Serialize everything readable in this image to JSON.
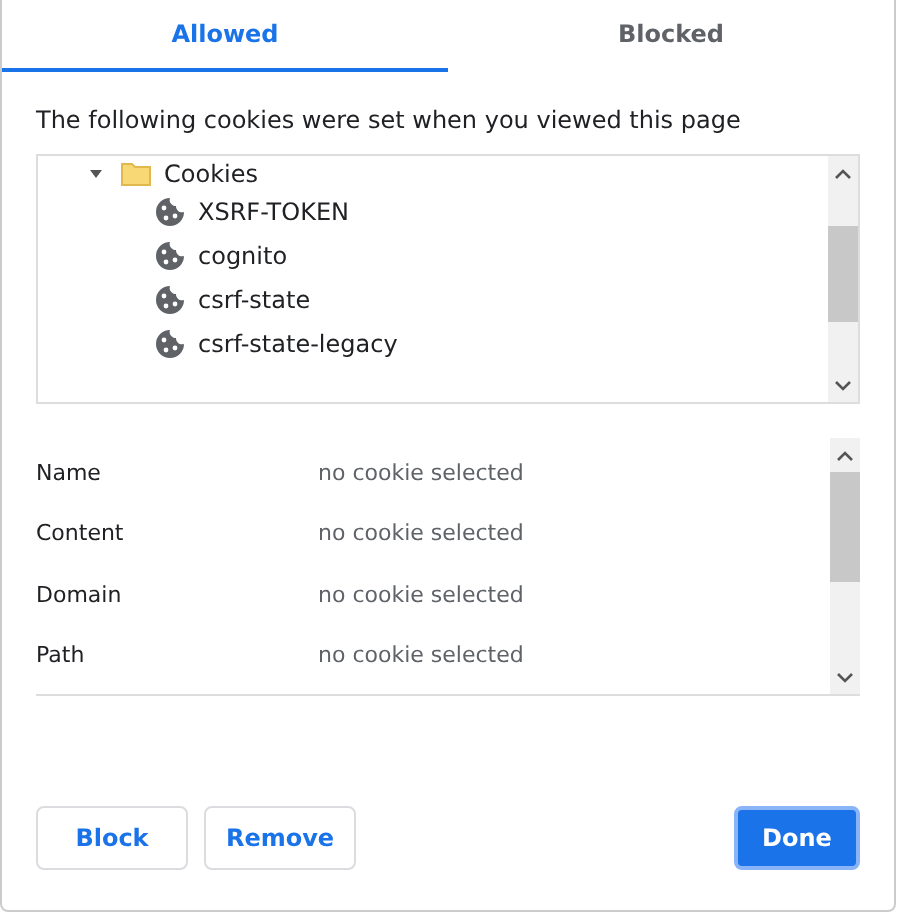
{
  "tabs": [
    {
      "label": "Allowed",
      "selected": true
    },
    {
      "label": "Blocked",
      "selected": false
    }
  ],
  "description": "The following cookies were set when you viewed this page",
  "tree": [
    {
      "label": "Cookies",
      "kind": "folder",
      "expanded": true,
      "children": [
        {
          "label": "XSRF-TOKEN",
          "kind": "cookie"
        },
        {
          "label": "cognito",
          "kind": "cookie"
        },
        {
          "label": "csrf-state",
          "kind": "cookie"
        },
        {
          "label": "csrf-state-legacy",
          "kind": "cookie"
        }
      ]
    }
  ],
  "details": [
    {
      "label": "Name",
      "value": "no cookie selected"
    },
    {
      "label": "Content",
      "value": "no cookie selected"
    },
    {
      "label": "Domain",
      "value": "no cookie selected"
    },
    {
      "label": "Path",
      "value": "no cookie selected"
    }
  ],
  "buttons": [
    {
      "label": "Block",
      "kind": "secondary"
    },
    {
      "label": "Remove",
      "kind": "secondary"
    },
    {
      "label": "Done",
      "kind": "primary"
    }
  ]
}
